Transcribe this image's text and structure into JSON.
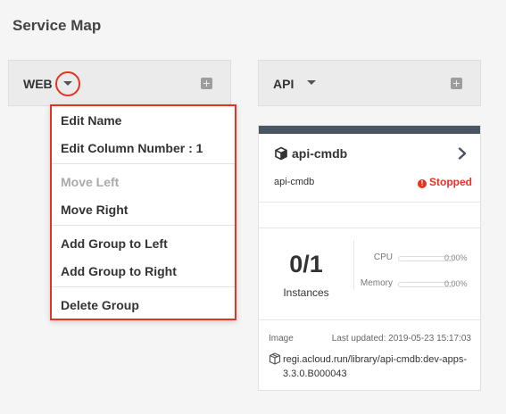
{
  "page": {
    "title": "Service Map"
  },
  "groups": [
    {
      "name": "WEB"
    },
    {
      "name": "API"
    }
  ],
  "menu": {
    "items": [
      {
        "label": "Edit Name",
        "disabled": false
      },
      {
        "label": "Edit Column Number : 1",
        "disabled": false
      },
      {
        "label": "Move Left",
        "disabled": true
      },
      {
        "label": "Move Right",
        "disabled": false
      },
      {
        "label": "Add Group to Left",
        "disabled": false
      },
      {
        "label": "Add Group to Right",
        "disabled": false
      },
      {
        "label": "Delete Group",
        "disabled": false
      }
    ]
  },
  "service_card": {
    "name": "api-cmdb",
    "subtitle": "api-cmdb",
    "status": "Stopped",
    "status_color": "#e53322",
    "instances": "0/1",
    "instances_label": "Instances",
    "metrics": [
      {
        "label": "CPU",
        "value": "0.00%",
        "fill": 0
      },
      {
        "label": "Memory",
        "value": "0.00%",
        "fill": 0
      }
    ],
    "image_label": "Image",
    "last_updated": "Last updated: 2019-05-23 15:17:03",
    "image_path": "regi.acloud.run/library/api-cmdb:dev-apps-3.3.0.B000043"
  },
  "colors": {
    "highlight": "#e53322",
    "card_topbar": "#4a5563"
  }
}
